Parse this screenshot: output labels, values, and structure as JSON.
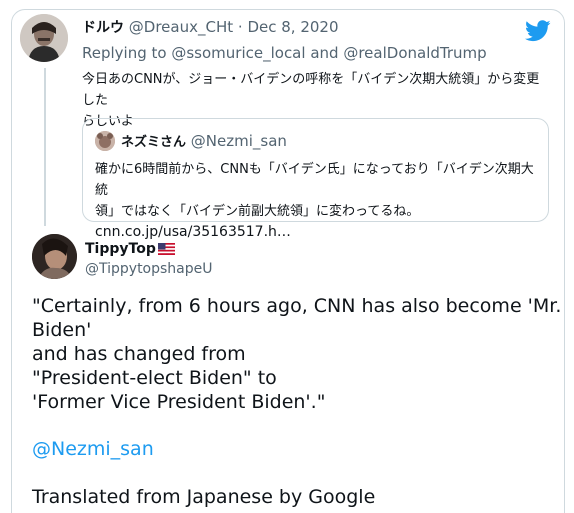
{
  "reply_tweet": {
    "author_name": "ドルウ",
    "author_handle": "@Dreaux_CHt",
    "separator": "·",
    "date": "Dec 8, 2020",
    "replying_prefix": "Replying to",
    "replying_to_1": "@ssomurice_local",
    "replying_and": "and",
    "replying_to_2": "@realDonaldTrump",
    "text_line1": "今日あのCNNが、ジョー・バイデンの呼称を「バイデン次期大統領」から変更した",
    "text_line2": "らしいよ",
    "quote": {
      "author_name": "ネズミさん",
      "author_handle": "@Nezmi_san",
      "text_line1": "確かに6時間前から、CNNも「バイデン氏」になっており「バイデン次期大統",
      "text_line2": "領」ではなく「バイデン前副大統領」に変わってるね。",
      "link": "cnn.co.jp/usa/35163517.h…"
    }
  },
  "main_tweet": {
    "author_name": "TippyTop",
    "author_handle": "@TippytopshapeU",
    "body_line1": "\"Certainly, from 6 hours ago, CNN has also become 'Mr.",
    "body_line2": "Biden'",
    "body_line3": "and has changed from",
    "body_line4": "\"President-elect Biden\" to",
    "body_line5": "'Former Vice President Biden'.\"",
    "mention": "@Nezmi_san",
    "translation_note": "Translated from Japanese by Google"
  },
  "icons": {
    "brand": "twitter-bird-icon",
    "flag": "us-flag-icon"
  },
  "colors": {
    "link_blue": "#1d9bf0",
    "secondary_text": "#536471",
    "border": "#cfd9de"
  }
}
